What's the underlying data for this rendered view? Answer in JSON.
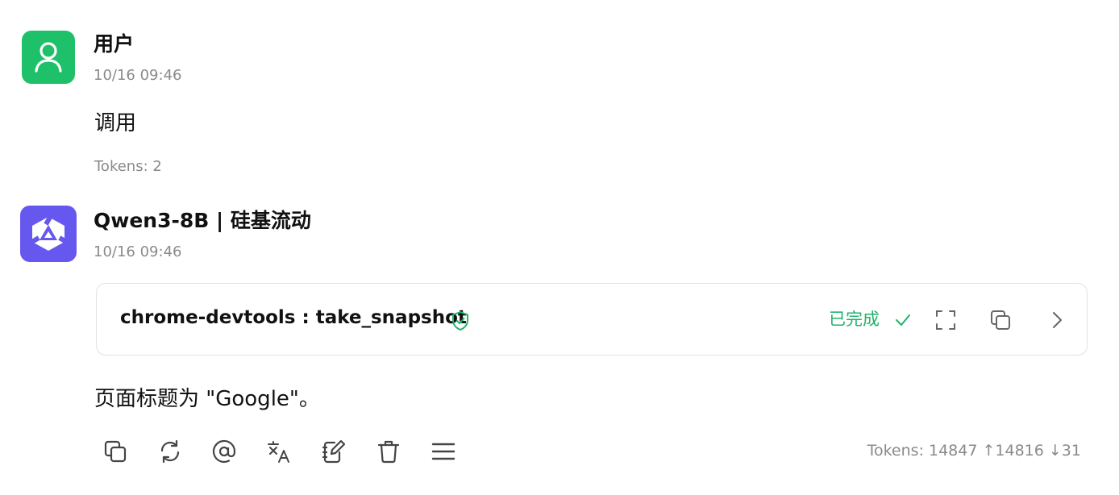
{
  "user_message": {
    "sender": "用户",
    "time": "10/16 09:46",
    "text": "调用",
    "tokens": "Tokens: 2"
  },
  "assistant_message": {
    "sender": "Qwen3-8B | 硅基流动",
    "time": "10/16 09:46",
    "tool_call": {
      "name": "chrome-devtools : take_snapshot",
      "status": "已完成"
    },
    "text": "页面标题为 \"Google\"。",
    "tokens": "Tokens: 14847 ↑14816 ↓31"
  },
  "colors": {
    "user_avatar": "#1ec06a",
    "assistant_avatar": "#6658ee",
    "status_green": "#1fb36b",
    "muted": "#8a8a8a"
  },
  "icons": {
    "user_avatar": "user-icon",
    "assistant_avatar": "qwen-logo-icon",
    "tool_verified": "shield-check-icon",
    "status_done": "check-icon",
    "card_actions": [
      "fullscreen-icon",
      "copy-icon",
      "chevron-right-icon"
    ],
    "toolbar": [
      "copy-icon",
      "refresh-icon",
      "mention-icon",
      "translate-icon",
      "edit-icon",
      "delete-icon",
      "menu-icon"
    ]
  }
}
